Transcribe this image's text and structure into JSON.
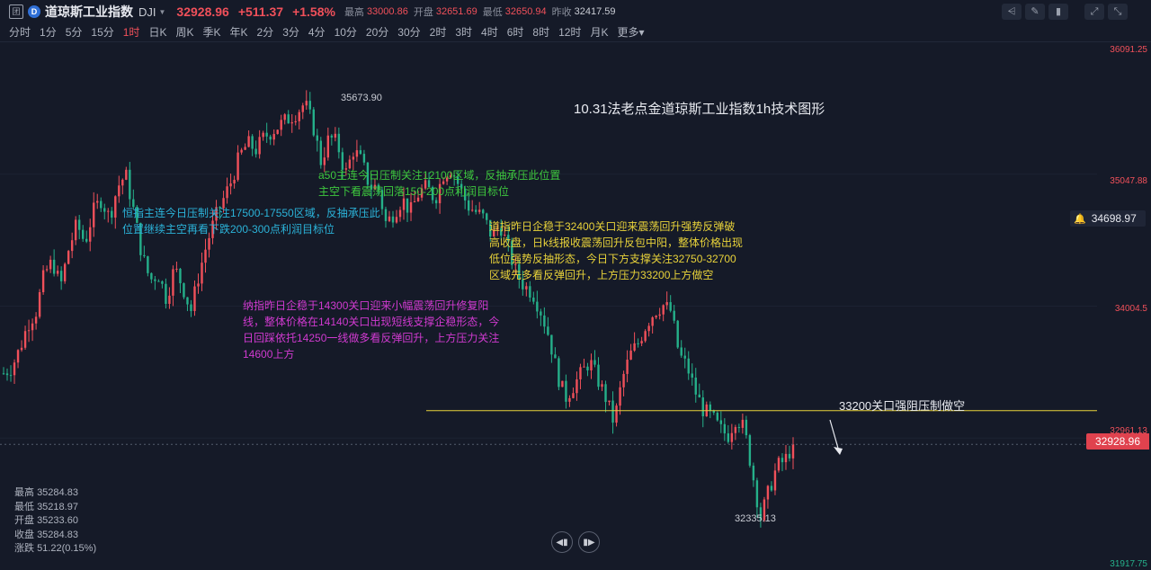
{
  "header": {
    "icon_label": "团",
    "logo_label": "D",
    "name": "道琼斯工业指数",
    "code": "DJI",
    "price": "32928.96",
    "change": "+511.37",
    "change_pct": "+1.58%",
    "high_label": "最高",
    "high": "33000.86",
    "open_label": "开盘",
    "open": "32651.69",
    "low_label": "最低",
    "low": "32650.94",
    "prev_label": "昨收",
    "prev": "32417.59"
  },
  "toolbar_icons": [
    "line-tool-icon",
    "edit-tool-icon",
    "delete-tool-icon",
    "fullscreen-icon",
    "popout-icon"
  ],
  "periods": [
    "分时",
    "1分",
    "5分",
    "15分",
    "1时",
    "日K",
    "周K",
    "季K",
    "年K",
    "2分",
    "3分",
    "4分",
    "10分",
    "20分",
    "30分",
    "2时",
    "3时",
    "4时",
    "6时",
    "8时",
    "12时",
    "月K"
  ],
  "active_period": "1时",
  "more_label": "更多",
  "y_axis": {
    "ticks": [
      "36091.25",
      "35047.88",
      "34004.5",
      "32961.13",
      "31917.75"
    ]
  },
  "annotations": {
    "title": "10.31法老点金道琼斯工业指数1h技术图形",
    "cyan": "恒指主连今日压制关注17500-17550区域，反抽承压此位置继续主空再看下跌200-300点利润目标位",
    "green": "a50主连今日压制关注12100区域，反抽承压此位置主空下看震荡回落150-200点利润目标位",
    "yellow": "道指昨日企稳于32400关口迎来震荡回升强势反弹破高收盘，日k线报收震荡回升反包中阳，整体价格出现低位强势反抽形态，今日下方支撑关注32750-32700区域先多看反弹回升，上方压力33200上方做空",
    "magenta": "纳指昨日企稳于14300关口迎来小幅震荡回升修复阳线，整体价格在14140关口出现短线支撑企稳形态，今日回踩依托14250一线做多看反弹回升，上方压力关注14600上方",
    "resistance": "33200关口强阻压制做空"
  },
  "chart_labels": {
    "high_point": "35673.90",
    "low_point": "32335.13",
    "alert_price": "34698.97",
    "current_price": "32928.96"
  },
  "info_panel": [
    {
      "label": "最高",
      "value": "35284.83"
    },
    {
      "label": "最低",
      "value": "35218.97"
    },
    {
      "label": "开盘",
      "value": "35233.60"
    },
    {
      "label": "收盘",
      "value": "35284.83"
    },
    {
      "label": "涨跌",
      "value": "51.22(0.15%)"
    }
  ],
  "nav": {
    "prev": "prev-icon",
    "next": "next-icon"
  },
  "colors": {
    "up": "#f0505a",
    "down": "#25b08a",
    "background": "#151a28",
    "resistance_line": "#e8d23a"
  },
  "chart_data": {
    "type": "candlestick",
    "title": "",
    "ylim": [
      31917.75,
      36091.25
    ],
    "series": [
      {
        "close_path": [
          33500,
          33550,
          33700,
          33900,
          34000,
          34300,
          34400,
          34200,
          34500,
          34700,
          34550,
          34800,
          34900,
          34750,
          35000,
          35100,
          34800,
          34450,
          34250,
          34300,
          34100,
          34350,
          34200,
          34000,
          34300,
          34550,
          34750,
          34900,
          35050,
          35250,
          35350,
          35300,
          35400,
          35450,
          35500,
          35550,
          35600,
          35673.9,
          35500,
          35200,
          35400,
          35350,
          35100,
          35300,
          35200,
          35000,
          35000,
          34700,
          34800,
          34900,
          34800,
          34950,
          35000,
          34900,
          35100,
          35150,
          35000,
          34850,
          34800,
          34750,
          34600,
          34700,
          34500,
          34300,
          34200,
          34150,
          34000,
          33800,
          33500,
          33300,
          33400,
          33500,
          33600,
          33450,
          33300,
          33100,
          33450,
          33650,
          33750,
          33900,
          34000,
          34050,
          34000,
          33650,
          33550,
          33350,
          33200,
          33150,
          33050,
          33000,
          33150,
          33050,
          32700,
          32335.13,
          32550,
          32750,
          32800,
          32928.96
        ]
      }
    ],
    "levels": [
      {
        "price": 33200,
        "label": "33200关口强阻压制做空"
      }
    ],
    "last_price": 32928.96
  }
}
